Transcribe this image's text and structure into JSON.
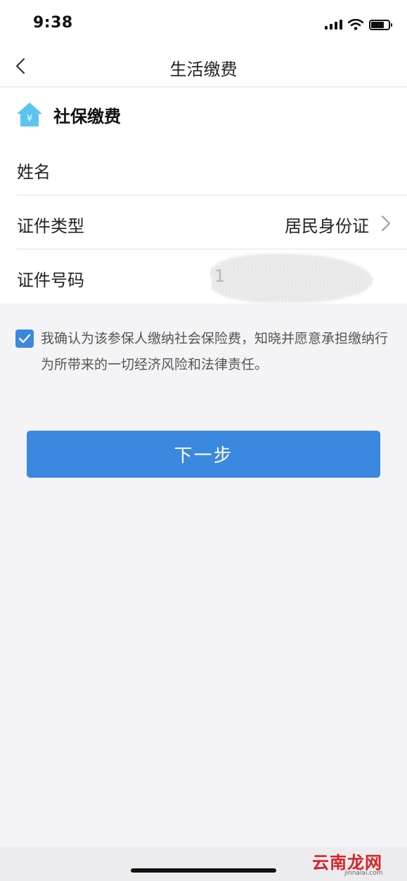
{
  "status": {
    "time": "9:38"
  },
  "nav": {
    "title": "生活缴费"
  },
  "section": {
    "title": "社保缴费",
    "icon": "house-yen-icon"
  },
  "form": {
    "name_label": "姓名",
    "name_value": "",
    "id_type_label": "证件类型",
    "id_type_value": "居民身份证",
    "id_number_label": "证件号码",
    "id_number_value": "1"
  },
  "agreement": {
    "checked": true,
    "text": "我确认为该参保人缴纳社会保险费，知晓并愿意承担缴纳行为所带来的一切经济风险和法律责任。"
  },
  "next_button": {
    "label": "下一步"
  },
  "colors": {
    "accent": "#3b88e0",
    "icon": "#5cc4ee"
  },
  "watermark": {
    "text": "云南龙网",
    "sub": "jinnalai.com"
  }
}
